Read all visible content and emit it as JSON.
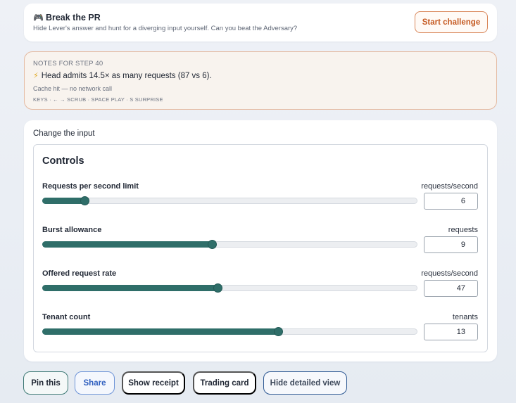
{
  "challenge": {
    "icon": "🎮",
    "title": "Break the PR",
    "subtitle": "Hide Lever's answer and hunt for a diverging input yourself. Can you beat the Adversary?",
    "start_label": "Start challenge"
  },
  "notes": {
    "heading": "NOTES FOR STEP 40",
    "main": "Head admits 14.5× as many requests (87 vs 6).",
    "status": "Cache hit — no network call",
    "keys": "KEYS · ← → SCRUB · SPACE PLAY · S SURPRISE"
  },
  "change": {
    "heading": "Change the input",
    "controls_title": "Controls",
    "rows": [
      {
        "label": "Requests per second limit",
        "unit": "requests/second",
        "value": "6",
        "fraction": 0.112
      },
      {
        "label": "Burst allowance",
        "unit": "requests",
        "value": "9",
        "fraction": 0.452
      },
      {
        "label": "Offered request rate",
        "unit": "requests/second",
        "value": "47",
        "fraction": 0.467
      },
      {
        "label": "Tenant count",
        "unit": "tenants",
        "value": "13",
        "fraction": 0.629
      }
    ]
  },
  "actions": {
    "pin": "Pin this",
    "share": "Share",
    "receipt": "Show receipt",
    "trading": "Trading card",
    "detail": "Hide detailed view"
  },
  "colors": {
    "slider_fill": "#2f6e69",
    "accent_orange": "#c55a22",
    "share_blue": "#2f5fbf"
  }
}
